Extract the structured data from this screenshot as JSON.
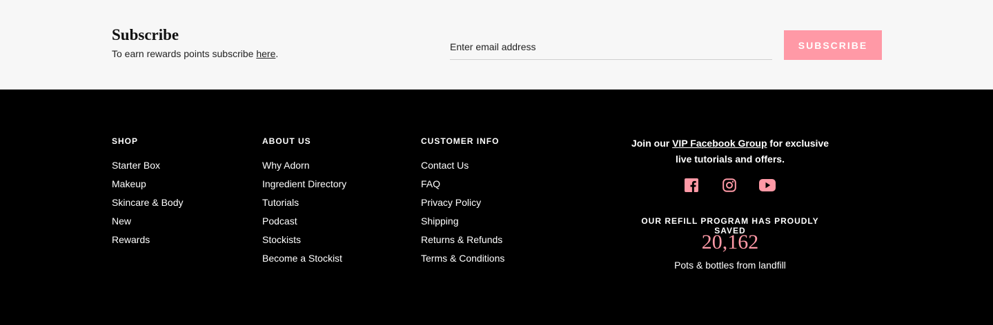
{
  "subscribe": {
    "title": "Subscribe",
    "text_before": "To earn rewards points subscribe ",
    "link_label": "here",
    "text_after": ".",
    "email_placeholder": "Enter email address",
    "button_label": "SUBSCRIBE"
  },
  "footer": {
    "shop": {
      "heading": "SHOP",
      "links": [
        "Starter Box",
        "Makeup",
        "Skincare & Body",
        "New",
        "Rewards"
      ]
    },
    "about": {
      "heading": "ABOUT US",
      "links": [
        "Why Adorn",
        "Ingredient Directory",
        "Tutorials",
        "Podcast",
        "Stockists",
        "Become a Stockist"
      ]
    },
    "customer_info": {
      "heading": "CUSTOMER INFO",
      "links": [
        "Contact Us",
        "FAQ",
        "Privacy Policy",
        "Shipping",
        "Returns & Refunds",
        "Terms & Conditions"
      ]
    },
    "vip": {
      "text_before": "Join our ",
      "link_label": "VIP Facebook Group",
      "text_after": " for exclusive live tutorials and offers."
    },
    "social": {
      "icons": [
        "facebook-icon",
        "instagram-icon",
        "youtube-icon"
      ],
      "color": "#ff99a6"
    },
    "refill": {
      "heading": "OUR REFILL PROGRAM HAS PROUDLY SAVED",
      "count": "20,162",
      "subtext": "Pots & bottles from landfill"
    }
  },
  "colors": {
    "accent": "#ff99a6",
    "footer_bg": "#000000",
    "subscribe_bg": "#f7f7f7"
  }
}
